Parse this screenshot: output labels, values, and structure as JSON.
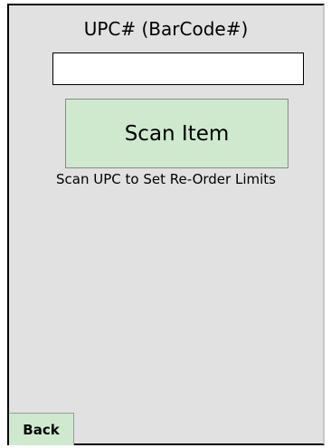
{
  "screen": {
    "title": "UPC# (BarCode#)",
    "upc_input": {
      "value": "",
      "placeholder": ""
    },
    "scan_button_label": "Scan Item",
    "hint": "Scan UPC to Set Re-Order Limits",
    "back_button_label": "Back"
  },
  "colors": {
    "background": "#e1e1e1",
    "button_fill": "#cfe9cf",
    "input_fill": "#ffffff"
  }
}
